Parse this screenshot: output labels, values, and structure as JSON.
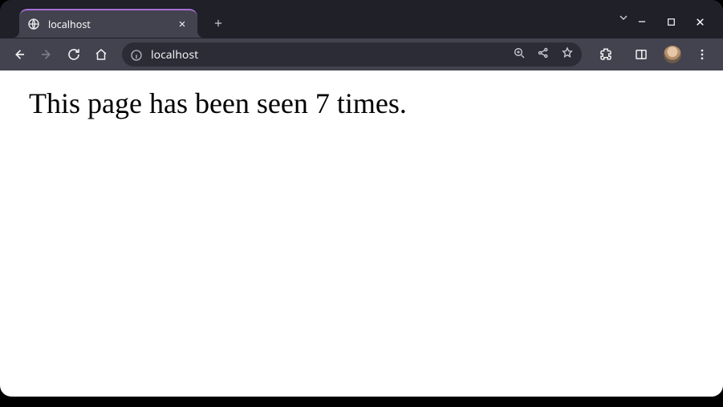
{
  "tab": {
    "title": "localhost"
  },
  "address": {
    "url": "localhost"
  },
  "page": {
    "body_text": "This page has been seen 7 times."
  }
}
